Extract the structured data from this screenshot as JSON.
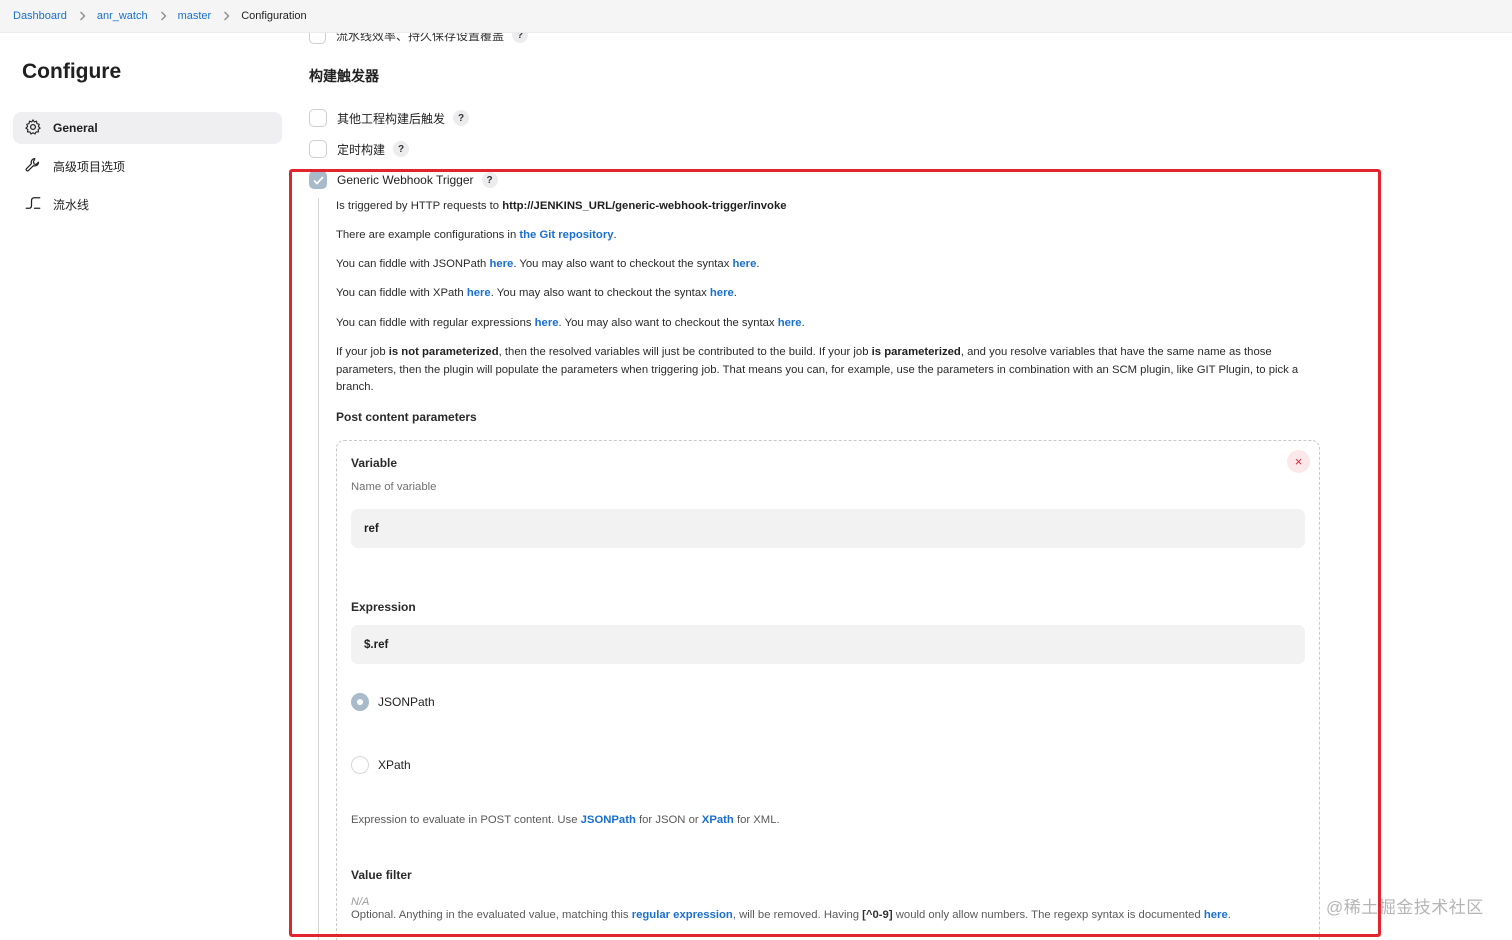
{
  "breadcrumb": [
    "Dashboard",
    "anr_watch",
    "master",
    "Configuration"
  ],
  "sidebar": {
    "title": "Configure",
    "items": [
      {
        "label": "General",
        "icon": "gear-icon",
        "active": true
      },
      {
        "label": "高级项目选项",
        "icon": "wrench-icon",
        "active": false
      },
      {
        "label": "流水线",
        "icon": "pipeline-icon",
        "active": false
      }
    ]
  },
  "cut_row": {
    "label": "流水线效率、持久保存设置覆盖"
  },
  "triggers": {
    "title": "构建触发器",
    "items": [
      {
        "label": "其他工程构建后触发",
        "checked": false
      },
      {
        "label": "定时构建",
        "checked": false
      },
      {
        "label": "Generic Webhook Trigger",
        "checked": true
      }
    ],
    "help": "?"
  },
  "gwt": {
    "line1": {
      "text": "Is triggered by HTTP requests to ",
      "url": "http://JENKINS_URL/generic-webhook-trigger/invoke"
    },
    "line2": {
      "text": "There are example configurations in ",
      "link": "the Git repository",
      "end": "."
    },
    "line3": {
      "a": "You can fiddle with JSONPath ",
      "link1": "here",
      "b": ". You may also want to checkout the syntax ",
      "link2": "here",
      "end": "."
    },
    "line4": {
      "a": "You can fiddle with XPath ",
      "link1": "here",
      "b": ". You may also want to checkout the syntax ",
      "link2": "here",
      "end": "."
    },
    "line5": {
      "a": "You can fiddle with regular expressions ",
      "link1": "here",
      "b": ". You may also want to checkout the syntax ",
      "link2": "here",
      "end": "."
    },
    "para": {
      "a": "If your job ",
      "b1": "is not parameterized",
      "c": ", then the resolved variables will just be contributed to the build. If your job ",
      "b2": "is parameterized",
      "d": ", and you resolve variables that have the same name as those parameters, then the plugin will populate the parameters when triggering job. That means you can, for example, use the parameters in combination with an SCM plugin, like GIT Plugin, to pick a branch."
    },
    "post_title": "Post content parameters",
    "close": "×",
    "variable": {
      "label": "Variable",
      "help": "Name of variable",
      "value": "ref"
    },
    "expression": {
      "label": "Expression",
      "value": "$.ref"
    },
    "radios": [
      {
        "label": "JSONPath",
        "selected": true
      },
      {
        "label": "XPath",
        "selected": false
      }
    ],
    "expr_hint": {
      "a": "Expression to evaluate in POST content. Use ",
      "link1": "JSONPath",
      "b": " for JSON or ",
      "link2": "XPath",
      "c": " for XML."
    },
    "value_filter": {
      "label": "Value filter",
      "placeholder": "N/A",
      "a": "Optional. Anything in the evaluated value, matching this ",
      "link1": "regular expression",
      "b": ", will be removed. Having ",
      "code": "[^0-9]",
      "c": " would only allow numbers. The regexp syntax is documented ",
      "link2": "here",
      "end": "."
    }
  },
  "watermark": "@稀土掘金技术社区",
  "colors": {
    "link": "#1a6fd0",
    "highlight": "#e2242f",
    "checked": "#a9bacb"
  }
}
